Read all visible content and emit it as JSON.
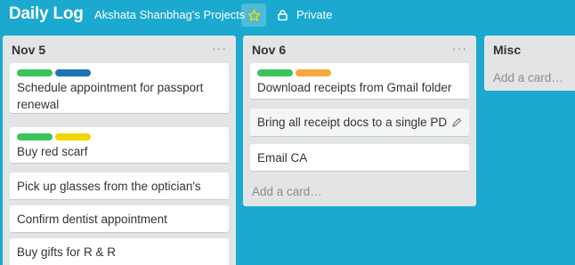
{
  "header": {
    "board_title": "Daily Log",
    "team_name": "Akshata Shanbhag's Projects",
    "star_icon": "star-icon",
    "privacy_icon": "lock-icon",
    "privacy_label": "Private"
  },
  "colors": {
    "background": "#1ba9d0",
    "list": "#e2e4e6",
    "green": "#3cc45a",
    "blue": "#1f74b5",
    "yellow": "#f2d600",
    "orange": "#f6a83e",
    "star": "#f2d600"
  },
  "lists": [
    {
      "title": "Nov 5",
      "menu": "···",
      "cards": [
        {
          "labels": [
            "green",
            "blue"
          ],
          "text": "Schedule appointment for passport renewal"
        },
        {
          "labels": [
            "green",
            "yellow"
          ],
          "text": "Buy red scarf"
        },
        {
          "labels": [],
          "text": "Pick up glasses from the optician's"
        },
        {
          "labels": [],
          "text": "Confirm dentist appointment"
        },
        {
          "labels": [],
          "text": "Buy gifts for R & R"
        }
      ]
    },
    {
      "title": "Nov 6",
      "menu": "···",
      "cards": [
        {
          "labels": [
            "green",
            "orange"
          ],
          "text": "Download receipts from Gmail folder"
        },
        {
          "labels": [],
          "text": "Bring all receipt docs to a single PDF"
        },
        {
          "labels": [],
          "text": "Email CA"
        }
      ],
      "add_card": "Add a card…"
    },
    {
      "title": "Misc",
      "add_card": "Add a card…"
    }
  ]
}
